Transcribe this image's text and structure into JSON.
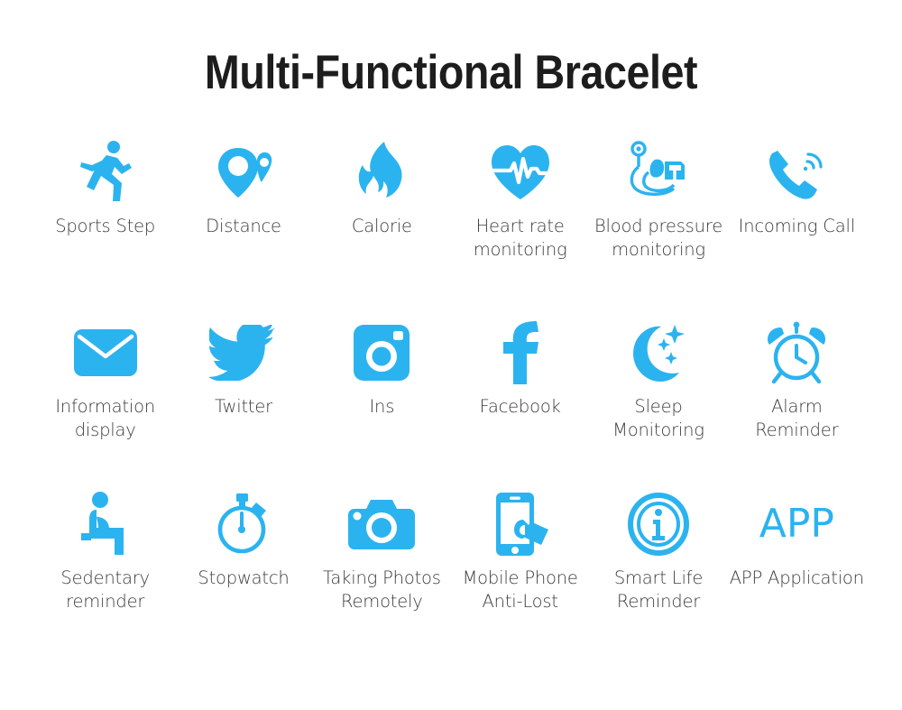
{
  "header": {
    "title": "Multi-Functional Bracelet"
  },
  "colors": {
    "icon_blue": "#2BB3F0",
    "label_text": "#3b3b3b",
    "title_text": "#1d1d1d",
    "background": "#ffffff"
  },
  "features": {
    "rows": [
      [
        {
          "icon": "running-person-icon",
          "label": "Sports Step"
        },
        {
          "icon": "location-pin-icon",
          "label": "Distance"
        },
        {
          "icon": "flame-icon",
          "label": "Calorie"
        },
        {
          "icon": "heart-pulse-icon",
          "label": "Heart rate\nmonitoring"
        },
        {
          "icon": "blood-pressure-monitor-icon",
          "label": "Blood pressure\nmonitoring"
        },
        {
          "icon": "incoming-call-icon",
          "label": "Incoming Call"
        }
      ],
      [
        {
          "icon": "envelope-icon",
          "label": "Information\ndisplay"
        },
        {
          "icon": "twitter-bird-icon",
          "label": "Twitter"
        },
        {
          "icon": "instagram-camera-icon",
          "label": "Ins"
        },
        {
          "icon": "facebook-f-icon",
          "label": "Facebook"
        },
        {
          "icon": "moon-stars-icon",
          "label": "Sleep\nMonitoring"
        },
        {
          "icon": "alarm-clock-icon",
          "label": "Alarm Reminder"
        }
      ],
      [
        {
          "icon": "seated-person-icon",
          "label": "Sedentary\nreminder"
        },
        {
          "icon": "stopwatch-icon",
          "label": "Stopwatch"
        },
        {
          "icon": "camera-icon",
          "label": "Taking Photos\nRemotely"
        },
        {
          "icon": "phone-tag-icon",
          "label": "Mobile Phone\nAnti-Lost"
        },
        {
          "icon": "info-circle-icon",
          "label": "Smart Life\nReminder"
        },
        {
          "icon": "app-text-icon",
          "label": "APP Application",
          "icon_text": "APP"
        }
      ]
    ]
  }
}
